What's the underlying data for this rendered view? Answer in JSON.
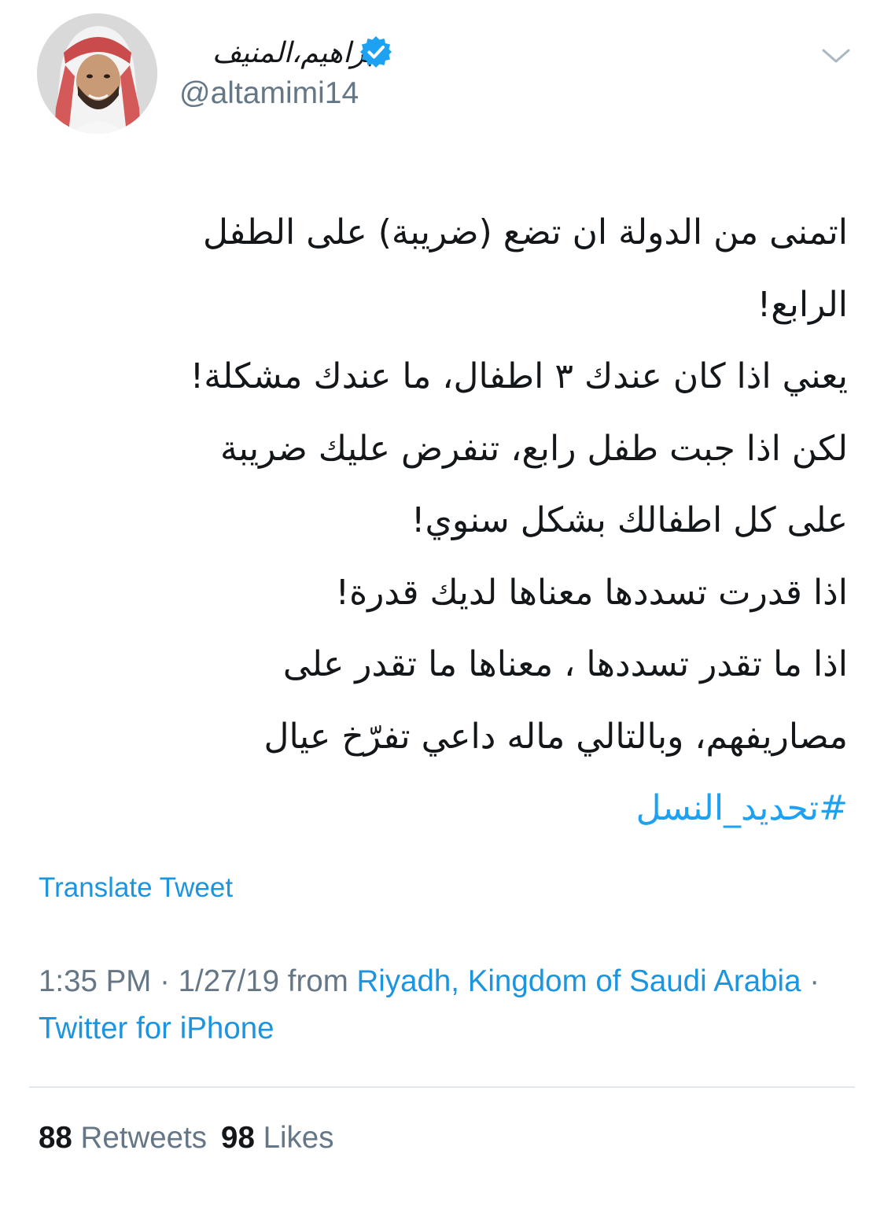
{
  "author": {
    "display_name": "ابراهيم،المنيف",
    "handle": "@altamimi14",
    "verified": true
  },
  "tweet": {
    "lines": [
      "اتمنى من الدولة ان تضع (ضريبة) على الطفل",
      "الرابع!",
      "يعني اذا كان عندك ٣ اطفال، ما عندك مشكلة!",
      "لكن اذا جبت طفل رابع، تنفرض عليك ضريبة",
      "على كل اطفالك بشكل سنوي!",
      "اذا قدرت تسددها معناها لديك قدرة!",
      "اذا ما تقدر تسددها ، معناها ما تقدر على",
      "مصاريفهم، وبالتالي ماله داعي تفرّخ عيال"
    ],
    "hashtag": "#تحديد_النسل"
  },
  "translate_label": "Translate Tweet",
  "meta": {
    "time": "1:35 PM",
    "sep1": " · ",
    "date": "1/27/19",
    "from_label": " from ",
    "location": "Riyadh, Kingdom of Saudi Arabia",
    "sep2": " · ",
    "source": "Twitter for iPhone"
  },
  "stats": {
    "retweets_count": "88",
    "retweets_label": "Retweets",
    "likes_count": "98",
    "likes_label": "Likes"
  },
  "colors": {
    "accent": "#1da1f2",
    "link": "#1b95e0",
    "text": "#14171a",
    "secondary": "#657786",
    "divider": "#e1e8ed"
  },
  "icons": {
    "verified": "verified-badge-icon",
    "caret": "chevron-down-icon",
    "avatar": "profile-avatar"
  }
}
